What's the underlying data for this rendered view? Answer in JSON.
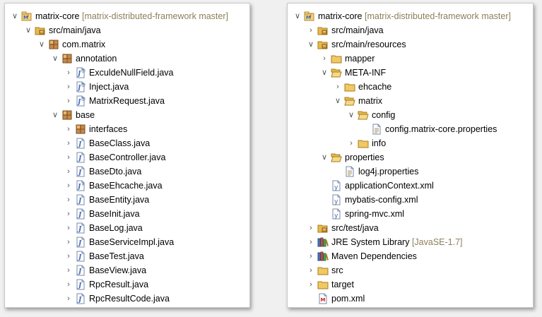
{
  "left_tree": [
    {
      "label": "matrix-core",
      "suffix": "[matrix-distributed-framework master]",
      "icon": "project-icon",
      "twisty": "expanded",
      "depth": 0
    },
    {
      "label": "src/main/java",
      "icon": "source-folder-icon",
      "twisty": "expanded",
      "depth": 1
    },
    {
      "label": "com.matrix",
      "icon": "package-icon",
      "twisty": "expanded",
      "depth": 2
    },
    {
      "label": "annotation",
      "icon": "package-icon",
      "twisty": "expanded",
      "depth": 3
    },
    {
      "label": "ExculdeNullField.java",
      "icon": "annotation-file-icon",
      "twisty": "collapsed",
      "depth": 4
    },
    {
      "label": "Inject.java",
      "icon": "annotation-file-icon",
      "twisty": "collapsed",
      "depth": 4
    },
    {
      "label": "MatrixRequest.java",
      "icon": "annotation-file-icon",
      "twisty": "collapsed",
      "depth": 4
    },
    {
      "label": "base",
      "icon": "package-icon",
      "twisty": "expanded",
      "depth": 3
    },
    {
      "label": "interfaces",
      "icon": "package-icon",
      "twisty": "collapsed",
      "depth": 4
    },
    {
      "label": "BaseClass.java",
      "icon": "java-file-icon",
      "twisty": "collapsed",
      "depth": 4
    },
    {
      "label": "BaseController.java",
      "icon": "java-file-icon",
      "twisty": "collapsed",
      "depth": 4
    },
    {
      "label": "BaseDto.java",
      "icon": "java-file-icon",
      "twisty": "collapsed",
      "depth": 4
    },
    {
      "label": "BaseEhcache.java",
      "icon": "abstract-java-file-icon",
      "twisty": "collapsed",
      "depth": 4
    },
    {
      "label": "BaseEntity.java",
      "icon": "java-file-icon",
      "twisty": "collapsed",
      "depth": 4
    },
    {
      "label": "BaseInit.java",
      "icon": "java-file-icon",
      "twisty": "collapsed",
      "depth": 4
    },
    {
      "label": "BaseLog.java",
      "icon": "java-file-icon",
      "twisty": "collapsed",
      "depth": 4
    },
    {
      "label": "BaseServiceImpl.java",
      "icon": "java-file-icon",
      "twisty": "collapsed",
      "depth": 4
    },
    {
      "label": "BaseTest.java",
      "icon": "java-file-icon",
      "twisty": "collapsed",
      "depth": 4
    },
    {
      "label": "BaseView.java",
      "icon": "java-file-icon",
      "twisty": "collapsed",
      "depth": 4
    },
    {
      "label": "RpcResult.java",
      "icon": "java-file-icon",
      "twisty": "collapsed",
      "depth": 4
    },
    {
      "label": "RpcResultCode.java",
      "icon": "java-file-icon",
      "twisty": "collapsed",
      "depth": 4
    }
  ],
  "right_tree": [
    {
      "label": "matrix-core",
      "suffix": "[matrix-distributed-framework master]",
      "icon": "project-icon",
      "twisty": "expanded",
      "depth": 0
    },
    {
      "label": "src/main/java",
      "icon": "source-folder-icon",
      "twisty": "collapsed",
      "depth": 1
    },
    {
      "label": "src/main/resources",
      "icon": "source-folder-icon",
      "twisty": "expanded",
      "depth": 1
    },
    {
      "label": "mapper",
      "icon": "folder-icon",
      "twisty": "collapsed",
      "depth": 2
    },
    {
      "label": "META-INF",
      "icon": "folder-open-icon",
      "twisty": "expanded",
      "depth": 2
    },
    {
      "label": "ehcache",
      "icon": "folder-icon",
      "twisty": "collapsed",
      "depth": 3
    },
    {
      "label": "matrix",
      "icon": "folder-open-icon",
      "twisty": "expanded",
      "depth": 3
    },
    {
      "label": "config",
      "icon": "folder-open-icon",
      "twisty": "expanded",
      "depth": 4
    },
    {
      "label": "config.matrix-core.properties",
      "icon": "properties-file-icon",
      "twisty": "none",
      "depth": 5
    },
    {
      "label": "info",
      "icon": "folder-icon",
      "twisty": "collapsed",
      "depth": 4
    },
    {
      "label": "properties",
      "icon": "folder-open-icon",
      "twisty": "expanded",
      "depth": 2
    },
    {
      "label": "log4j.properties",
      "icon": "properties-file-icon",
      "twisty": "none",
      "depth": 3
    },
    {
      "label": "applicationContext.xml",
      "icon": "xml-file-icon",
      "twisty": "none",
      "depth": 2
    },
    {
      "label": "mybatis-config.xml",
      "icon": "xml-file-icon",
      "twisty": "none",
      "depth": 2
    },
    {
      "label": "spring-mvc.xml",
      "icon": "xml-file-icon",
      "twisty": "none",
      "depth": 2
    },
    {
      "label": "src/test/java",
      "icon": "source-folder-icon",
      "twisty": "collapsed",
      "depth": 1
    },
    {
      "label": "JRE System Library",
      "suffix": "[JavaSE-1.7]",
      "icon": "library-icon",
      "twisty": "collapsed",
      "depth": 1
    },
    {
      "label": "Maven Dependencies",
      "icon": "library-icon",
      "twisty": "collapsed",
      "depth": 1
    },
    {
      "label": "src",
      "icon": "folder-icon",
      "twisty": "collapsed",
      "depth": 1
    },
    {
      "label": "target",
      "icon": "folder-icon",
      "twisty": "collapsed",
      "depth": 1
    },
    {
      "label": "pom.xml",
      "icon": "maven-pom-icon",
      "twisty": "none",
      "depth": 1
    }
  ],
  "colors": {
    "suffix_text": "#8b7f5a",
    "folder": "#e9b94a",
    "package": "#a0713c",
    "java_blue": "#3d6bb5"
  }
}
